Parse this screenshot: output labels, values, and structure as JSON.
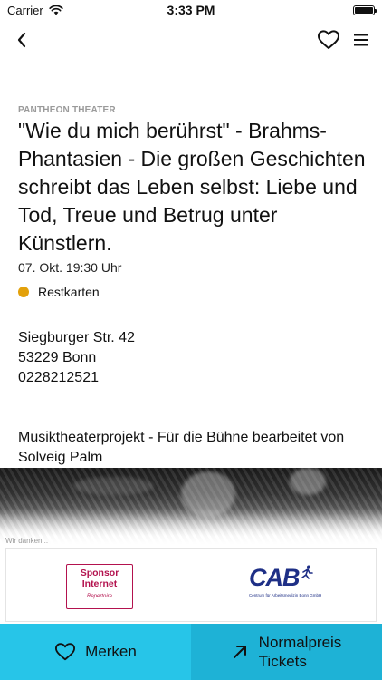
{
  "status_bar": {
    "carrier": "Carrier",
    "time": "3:33 PM"
  },
  "nav": {
    "back_icon": "chevron-left-icon",
    "favorite_icon": "heart-icon",
    "menu_icon": "hamburger-icon"
  },
  "event": {
    "venue": "PANTHEON THEATER",
    "title": "\"Wie du mich berührst\" - Brahms-Phantasien - Die großen Geschichten schreibt das Leben selbst: Liebe und Tod, Treue und Betrug unter Künstlern.",
    "date": "07. Okt. 19:30 Uhr",
    "availability": {
      "label": "Restkarten",
      "color": "#e3a10b"
    },
    "address": {
      "street": "Siegburger Str. 42",
      "city": "53229 Bonn",
      "phone": "0228212521"
    },
    "description": "Musiktheaterprojekt - Für die Bühne bearbeitet von Solveig Palm"
  },
  "sponsors": {
    "thanks": "Wir danken...",
    "sponsor_internet": {
      "line1": "Sponsor",
      "line2": "Internet",
      "line3": "Repertoire"
    },
    "cab": {
      "name": "CAB",
      "subtitle": "Centrum für Arbeitsmedizin Bonn GmbH"
    }
  },
  "actions": {
    "merken_label": "Merken",
    "tickets_line1": "Normalpreis",
    "tickets_line2": "Tickets"
  },
  "colors": {
    "merken_bg": "#27c5e8",
    "tickets_bg": "#1eb2d6",
    "sponsor_red": "#b3124e",
    "cab_blue": "#1e2f86"
  }
}
